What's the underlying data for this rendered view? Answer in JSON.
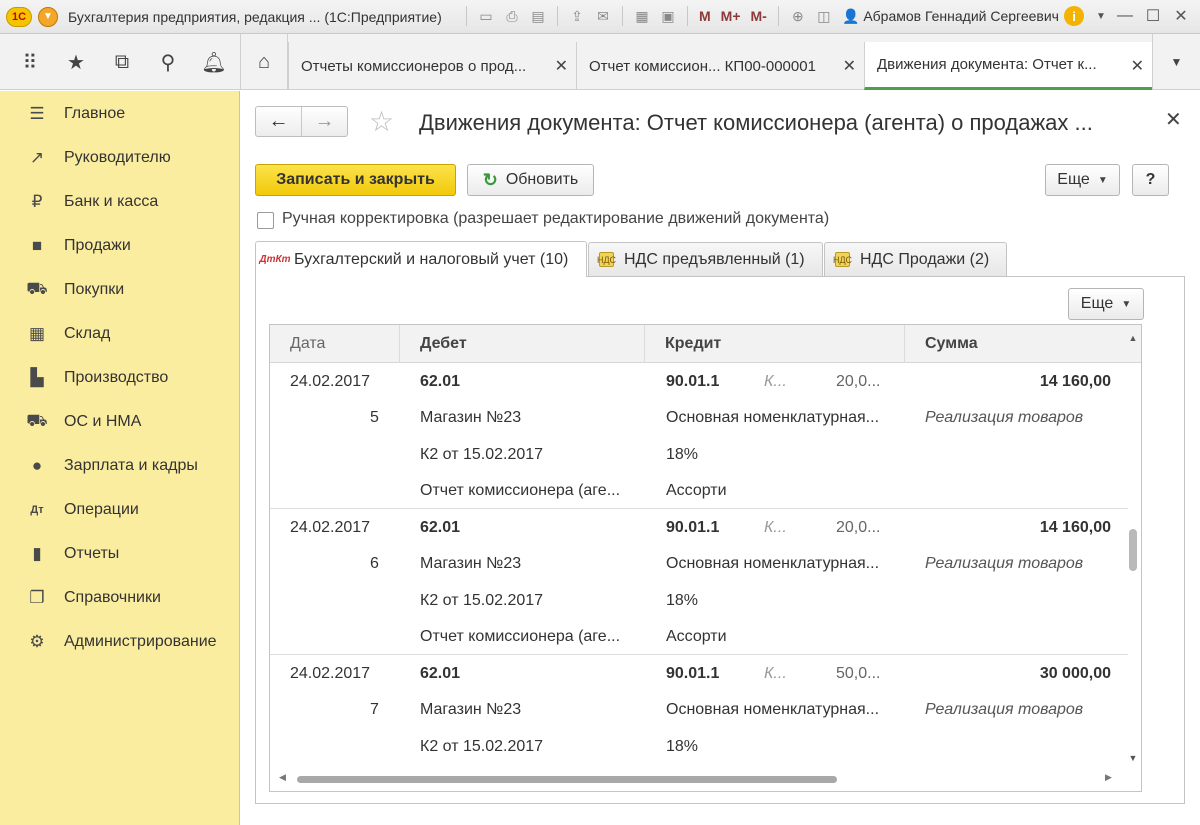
{
  "titlebar": {
    "logo_text": "1С",
    "title": "Бухгалтерия предприятия, редакция ... (1С:Предприятие)",
    "memory_buttons": [
      "M",
      "M+",
      "M-"
    ],
    "user": "Абрамов Геннадий Сергеевич",
    "info_label": "i"
  },
  "tabs": [
    {
      "label": "Отчеты комиссионеров о прод...",
      "active": false
    },
    {
      "label": "Отчет комиссион...  КП00-000001",
      "active": false
    },
    {
      "label": "Движения документа: Отчет к...",
      "active": true
    }
  ],
  "sidebar": {
    "items": [
      {
        "label": "Главное",
        "icon": "menu-icon"
      },
      {
        "label": "Руководителю",
        "icon": "trend-icon"
      },
      {
        "label": "Банк и касса",
        "icon": "ruble-icon"
      },
      {
        "label": "Продажи",
        "icon": "bag-icon"
      },
      {
        "label": "Покупки",
        "icon": "cart-icon"
      },
      {
        "label": "Склад",
        "icon": "warehouse-icon"
      },
      {
        "label": "Производство",
        "icon": "factory-icon"
      },
      {
        "label": "ОС и НМА",
        "icon": "truck-icon"
      },
      {
        "label": "Зарплата и кадры",
        "icon": "person-icon"
      },
      {
        "label": "Операции",
        "icon": "dt-kt-icon"
      },
      {
        "label": "Отчеты",
        "icon": "bar-chart-icon"
      },
      {
        "label": "Справочники",
        "icon": "books-icon"
      },
      {
        "label": "Администрирование",
        "icon": "gear-icon"
      }
    ]
  },
  "document": {
    "title": "Движения документа: Отчет комиссионера (агента) о продажах ...",
    "save_close_label": "Записать и закрыть",
    "refresh_label": "Обновить",
    "more_label": "Еще",
    "help_label": "?",
    "manual_correction_label": "Ручная корректировка (разрешает редактирование движений документа)",
    "manual_correction_checked": false
  },
  "form_tabs": [
    {
      "label": "Бухгалтерский и налоговый учет (10)",
      "icon_text": "ДтКт",
      "active": true
    },
    {
      "label": "НДС предъявленный (1)",
      "icon_text": "НДС",
      "active": false
    },
    {
      "label": "НДС Продажи (2)",
      "icon_text": "НДС",
      "active": false
    }
  ],
  "table": {
    "more_label": "Еще",
    "headers": {
      "date": "Дата",
      "debit": "Дебет",
      "credit": "Кредит",
      "sum": "Сумма"
    },
    "rows": [
      {
        "date": "24.02.2017",
        "num": "5",
        "debit": [
          "62.01",
          "Магазин №23",
          "К2 от 15.02.2017",
          "Отчет комиссионера (аге..."
        ],
        "credit": [
          "90.01.1",
          "Основная номенклатурная...",
          "18%",
          "Ассорти"
        ],
        "credit_extra_k": "К...",
        "credit_extra_qty": "20,0...",
        "sum": "14 160,00",
        "sum_note": "Реализация товаров"
      },
      {
        "date": "24.02.2017",
        "num": "6",
        "debit": [
          "62.01",
          "Магазин №23",
          "К2 от 15.02.2017",
          "Отчет комиссионера (аге..."
        ],
        "credit": [
          "90.01.1",
          "Основная номенклатурная...",
          "18%",
          "Ассорти"
        ],
        "credit_extra_k": "К...",
        "credit_extra_qty": "20,0...",
        "sum": "14 160,00",
        "sum_note": "Реализация товаров"
      },
      {
        "date": "24.02.2017",
        "num": "7",
        "debit": [
          "62.01",
          "Магазин №23",
          "К2 от 15.02.2017",
          ""
        ],
        "credit": [
          "90.01.1",
          "Основная номенклатурная...",
          "18%",
          ""
        ],
        "credit_extra_k": "К...",
        "credit_extra_qty": "50,0...",
        "sum": "30 000,00",
        "sum_note": "Реализация товаров"
      }
    ]
  },
  "colors": {
    "sidebar_bg": "#fbeda0",
    "primary_button": "#f2c90a",
    "active_tab_underline": "#4aa14a"
  }
}
